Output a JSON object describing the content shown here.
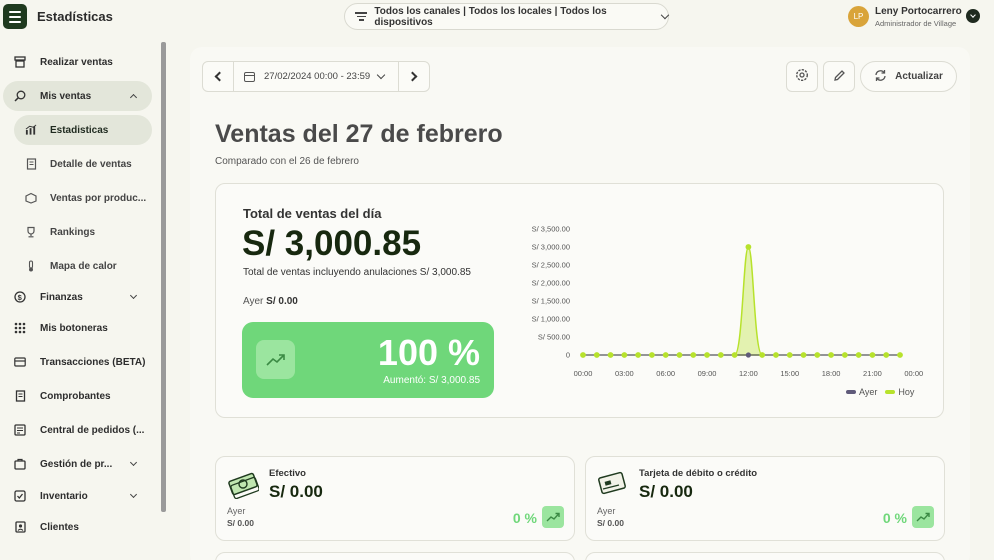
{
  "app": {
    "title": "Estadísticas"
  },
  "filter": {
    "label": "Todos los canales | Todos los locales | Todos los dispositivos"
  },
  "user": {
    "initials": "LP",
    "name": "Leny Portocarrero",
    "role": "Administrador de Village"
  },
  "sidebar": {
    "items": [
      {
        "label": "Realizar ventas",
        "icon": "register-icon"
      },
      {
        "label": "Mis ventas",
        "icon": "search-money-icon"
      },
      {
        "label": "Estadisticas",
        "icon": "bar-chart-icon"
      },
      {
        "label": "Detalle de ventas",
        "icon": "receipt-icon"
      },
      {
        "label": "Ventas por produc...",
        "icon": "box-icon"
      },
      {
        "label": "Rankings",
        "icon": "trophy-icon"
      },
      {
        "label": "Mapa de calor",
        "icon": "thermometer-icon"
      },
      {
        "label": "Finanzas",
        "icon": "finance-icon"
      },
      {
        "label": "Mis botoneras",
        "icon": "grid-icon"
      },
      {
        "label": "Transacciones (BETA)",
        "icon": "card-icon"
      },
      {
        "label": "Comprobantes",
        "icon": "document-icon"
      },
      {
        "label": "Central de pedidos (...",
        "icon": "orders-icon"
      },
      {
        "label": "Gestión de pr...",
        "icon": "product-icon"
      },
      {
        "label": "Inventario",
        "icon": "inventory-icon"
      },
      {
        "label": "Clientes",
        "icon": "client-icon"
      }
    ]
  },
  "datebar": {
    "range": "27/02/2024 00:00 - 23:59"
  },
  "toolbar": {
    "update_label": "Actualizar"
  },
  "page": {
    "title": "Ventas del 27 de febrero",
    "subtitle": "Comparado con el 26 de febrero"
  },
  "summary": {
    "label": "Total de ventas del día",
    "value": "S/ 3,000.85",
    "note": "Total de ventas incluyendo anulaciones S/ 3,000.85",
    "prev_label": "Ayer",
    "prev_value": "S/ 0.00",
    "pct": "100 %",
    "pct_note": "Aumentó: S/ 3,000.85",
    "accent": "#6fd77a"
  },
  "chart_data": {
    "type": "line",
    "title": "",
    "xlabel": "",
    "ylabel": "",
    "ylim": [
      0,
      3500
    ],
    "y_ticks": [
      "0",
      "S/ 500.00",
      "S/ 1,000.00",
      "S/ 1,500.00",
      "S/ 2,000.00",
      "S/ 2,500.00",
      "S/ 3,000.00",
      "S/ 3,500.00"
    ],
    "x_ticks": [
      "00:00",
      "03:00",
      "06:00",
      "09:00",
      "12:00",
      "15:00",
      "18:00",
      "21:00",
      "00:00"
    ],
    "x": [
      0,
      1,
      2,
      3,
      4,
      5,
      6,
      7,
      8,
      9,
      10,
      11,
      12,
      13,
      14,
      15,
      16,
      17,
      18,
      19,
      20,
      21,
      22,
      23
    ],
    "series": [
      {
        "name": "Ayer",
        "color": "#5f5a7a",
        "values": [
          0,
          0,
          0,
          0,
          0,
          0,
          0,
          0,
          0,
          0,
          0,
          0,
          0,
          0,
          0,
          0,
          0,
          0,
          0,
          0,
          0,
          0,
          0,
          0
        ]
      },
      {
        "name": "Hoy",
        "color": "#b7e22c",
        "values": [
          0,
          0,
          0,
          0,
          0,
          0,
          0,
          0,
          0,
          0,
          0,
          0,
          3000.85,
          0,
          0,
          0,
          0,
          0,
          0,
          0,
          0,
          0,
          0,
          0
        ]
      }
    ],
    "legend": "bottom-right",
    "grid": false
  },
  "payments": [
    {
      "name": "Efectivo",
      "value": "S/ 0.00",
      "prev_label": "Ayer",
      "prev_value": "S/ 0.00",
      "pct": "0 %",
      "icon": "cash-icon"
    },
    {
      "name": "Tarjeta de débito o crédito",
      "value": "S/ 0.00",
      "prev_label": "Ayer",
      "prev_value": "S/ 0.00",
      "pct": "0 %",
      "icon": "credit-card-icon"
    }
  ]
}
